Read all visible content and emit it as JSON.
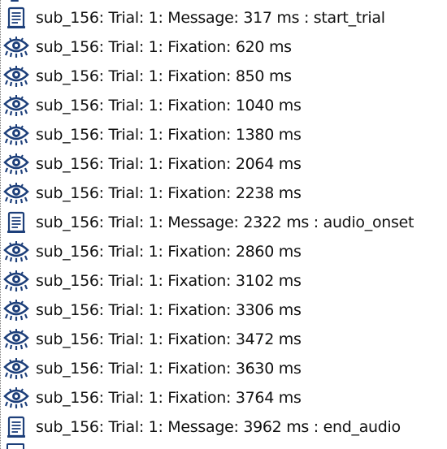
{
  "tree": {
    "items": [
      {
        "type": "message",
        "icon": "message-document-icon",
        "label": "sub_156: Trial: 1: Message: 317 ms : start_trial"
      },
      {
        "type": "fixation",
        "icon": "eye-icon",
        "label": "sub_156: Trial: 1: Fixation: 620 ms"
      },
      {
        "type": "fixation",
        "icon": "eye-icon",
        "label": "sub_156: Trial: 1: Fixation: 850 ms"
      },
      {
        "type": "fixation",
        "icon": "eye-icon",
        "label": "sub_156: Trial: 1: Fixation: 1040 ms"
      },
      {
        "type": "fixation",
        "icon": "eye-icon",
        "label": "sub_156: Trial: 1: Fixation: 1380 ms"
      },
      {
        "type": "fixation",
        "icon": "eye-icon",
        "label": "sub_156: Trial: 1: Fixation: 2064 ms"
      },
      {
        "type": "fixation",
        "icon": "eye-icon",
        "label": "sub_156: Trial: 1: Fixation: 2238 ms"
      },
      {
        "type": "message",
        "icon": "message-document-icon",
        "label": "sub_156: Trial: 1: Message: 2322 ms : audio_onset"
      },
      {
        "type": "fixation",
        "icon": "eye-icon",
        "label": "sub_156: Trial: 1: Fixation: 2860 ms"
      },
      {
        "type": "fixation",
        "icon": "eye-icon",
        "label": "sub_156: Trial: 1: Fixation: 3102 ms"
      },
      {
        "type": "fixation",
        "icon": "eye-icon",
        "label": "sub_156: Trial: 1: Fixation: 3306 ms"
      },
      {
        "type": "fixation",
        "icon": "eye-icon",
        "label": "sub_156: Trial: 1: Fixation: 3472 ms"
      },
      {
        "type": "fixation",
        "icon": "eye-icon",
        "label": "sub_156: Trial: 1: Fixation: 3630 ms"
      },
      {
        "type": "fixation",
        "icon": "eye-icon",
        "label": "sub_156: Trial: 1: Fixation: 3764 ms"
      },
      {
        "type": "message",
        "icon": "message-document-icon",
        "label": "sub_156: Trial: 1: Message: 3962 ms : end_audio"
      }
    ]
  },
  "colors": {
    "icon_blue": "#1d3f7a",
    "text": "#111111"
  }
}
